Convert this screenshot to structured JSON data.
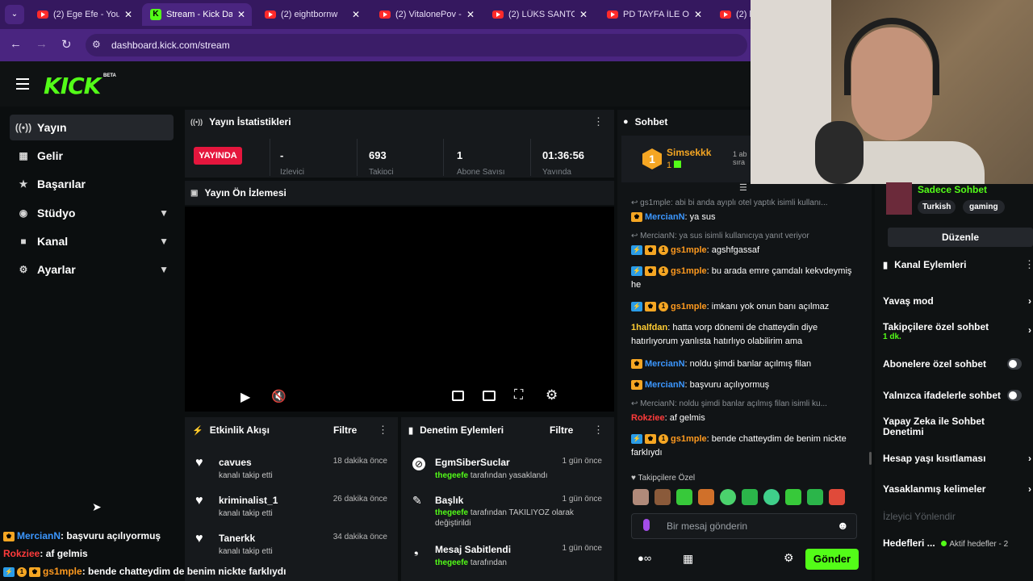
{
  "browser": {
    "tabs": [
      {
        "title": "(2) Ege Efe - You"
      },
      {
        "title": "Stream - Kick Da"
      },
      {
        "title": "(2) eightbornw"
      },
      {
        "title": "(2) VitalonePov -"
      },
      {
        "title": "(2) LÜKS SANTO"
      },
      {
        "title": "PD TAYFA İLE OF"
      },
      {
        "title": "(2) h"
      }
    ],
    "url": "dashboard.kick.com/stream"
  },
  "brand": {
    "logo": "KICK",
    "beta": "BETA",
    "accent": "#53fc18"
  },
  "sidebar": {
    "items": [
      {
        "label": "Yayın",
        "icon": "broadcast-icon"
      },
      {
        "label": "Gelir",
        "icon": "revenue-icon"
      },
      {
        "label": "Başarılar",
        "icon": "trophy-icon"
      },
      {
        "label": "Stüdyo",
        "icon": "studio-icon"
      },
      {
        "label": "Kanal",
        "icon": "channel-icon"
      },
      {
        "label": "Ayarlar",
        "icon": "gear-icon"
      }
    ]
  },
  "stats": {
    "title": "Yayın İstatistikleri",
    "live": "YAYINDA",
    "cells": [
      {
        "value": "-",
        "label": "İzleyici"
      },
      {
        "value": "693",
        "label": "Takipçi"
      },
      {
        "value": "1",
        "label": "Abone Sayısı"
      },
      {
        "value": "01:36:56",
        "label": "Yayında"
      }
    ]
  },
  "preview": {
    "title": "Yayın Ön İzlemesi"
  },
  "activity": {
    "title": "Etkinlik Akışı",
    "filter": "Filtre",
    "items": [
      {
        "name": "cavues",
        "sub": "kanalı takip etti",
        "time": "18 dakika önce"
      },
      {
        "name": "kriminalist_1",
        "sub": "kanalı takip etti",
        "time": "26 dakika önce"
      },
      {
        "name": "Tanerkk",
        "sub": "kanalı takip etti",
        "time": "34 dakika önce"
      }
    ]
  },
  "moderation": {
    "title": "Denetim Eylemleri",
    "filter": "Filtre",
    "items": [
      {
        "name": "EgmSiberSuclar",
        "by": "thegeefe",
        "action": "tarafından yasaklandı",
        "time": "1 gün önce"
      },
      {
        "name": "Başlık",
        "by": "thegeefe",
        "action": "tarafından TAKILIYOZ olarak değiştirildi",
        "time": "1 gün önce"
      },
      {
        "name": "Mesaj Sabitlendi",
        "by": "thegeefe",
        "action": "tarafından",
        "time": "1 gün önce"
      }
    ]
  },
  "chat": {
    "title": "Sohbet",
    "top_gifter": {
      "name": "Simsekkk",
      "count": "1",
      "rank": "1"
    },
    "side_note": "1 ab sıra",
    "messages": [
      {
        "reply": "gs1mple: abi bi anda ayıplı otel yaptık isimli kullanı..."
      },
      {
        "user": "MercianN",
        "color": "#3c97ff",
        "text": "ya sus"
      },
      {
        "reply": "MercianN: ya sus isimli kullanıcıya yanıt veriyor"
      },
      {
        "user": "gs1mple",
        "color": "#ff9a1f",
        "text": "agshfgassaf"
      },
      {
        "user": "gs1mple",
        "color": "#ff9a1f",
        "text": "bu arada emre çamdalı kekvdeymiş he"
      },
      {
        "user": "gs1mple",
        "color": "#ff9a1f",
        "text": "imkanı yok onun banı açılmaz"
      },
      {
        "user": "1halfdan",
        "color": "#ffcc33",
        "text": "hatta vorp dönemi de chatteydin diye hatırlıyorum yanlısta hatırlıyo olabilirim ama"
      },
      {
        "user": "MercianN",
        "color": "#3c97ff",
        "text": "noldu şimdi banlar açılmış filan"
      },
      {
        "user": "MercianN",
        "color": "#3c97ff",
        "text": "başvuru açılıyormuş"
      },
      {
        "reply": "MercianN: noldu şimdi banlar açılmış filan isimli ku..."
      },
      {
        "user": "Rokziee",
        "color": "#ff3b3b",
        "text": "af gelmis"
      },
      {
        "user": "gs1mple",
        "color": "#ff9a1f",
        "text": "bende chatteydim de benim nickte farklıydı"
      }
    ],
    "emote_label": "Takipçilere Özel",
    "placeholder": "Bir mesaj gönderin",
    "send": "Gönder"
  },
  "right_panel": {
    "title": "Sadece Sohbet",
    "tags": [
      "Turkish",
      "gaming"
    ],
    "edit": "Düzenle",
    "actions_title": "Kanal Eylemleri",
    "rows": [
      {
        "label": "Yavaş mod",
        "sub": ""
      },
      {
        "label": "Takipçilere özel sohbet",
        "sub": "1 dk."
      },
      {
        "label": "Abonelere özel sohbet",
        "sub": ""
      },
      {
        "label": "Yalnızca ifadelerle sohbet",
        "sub": ""
      },
      {
        "label": "Yapay Zeka ile Sohbet Denetimi",
        "sub": ""
      },
      {
        "label": "Hesap yaşı kısıtlaması",
        "sub": ""
      },
      {
        "label": "Yasaklanmış kelimeler",
        "sub": ""
      },
      {
        "label": "İzleyici Yönlendir",
        "sub": ""
      },
      {
        "label": "Hedefleri ...",
        "sub": "Aktif hedefler - 2"
      }
    ]
  },
  "overlay_chat": [
    {
      "user": "MercianN",
      "color": "#3c97ff",
      "text": ": başvuru açılıyormuş"
    },
    {
      "user": "Rokziee",
      "color": "#ff3b3b",
      "text": ": af gelmis"
    },
    {
      "user": "gs1mple",
      "color": "#ff9a1f",
      "text": ": bende chatteydim de benim nickte farklıydı"
    }
  ]
}
